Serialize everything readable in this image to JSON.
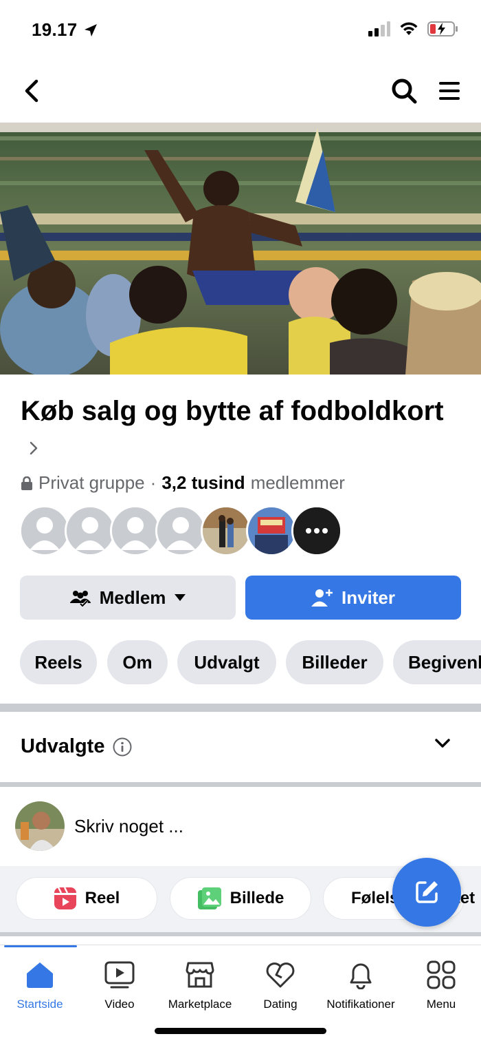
{
  "status_bar": {
    "time": "19.17"
  },
  "group": {
    "title": "Køb salg og bytte af fodboldkort",
    "privacy": "Privat gruppe",
    "separator": "·",
    "member_count": "3,2 tusind",
    "member_word": "medlemmer"
  },
  "buttons": {
    "member": "Medlem",
    "invite": "Inviter"
  },
  "chips": [
    "Reels",
    "Om",
    "Udvalgt",
    "Billeder",
    "Begivenheder"
  ],
  "featured": {
    "label": "Udvalgte"
  },
  "composer": {
    "placeholder": "Skriv noget ..."
  },
  "actions": [
    {
      "label": "Reel",
      "icon": "reel-icon"
    },
    {
      "label": "Billede",
      "icon": "photo-icon"
    },
    {
      "label": "Følelse/aktivitet",
      "icon": "feeling-icon"
    }
  ],
  "tabbar": [
    {
      "label": "Startside",
      "icon": "home-icon"
    },
    {
      "label": "Video",
      "icon": "video-icon"
    },
    {
      "label": "Marketplace",
      "icon": "marketplace-icon"
    },
    {
      "label": "Dating",
      "icon": "dating-icon"
    },
    {
      "label": "Notifikationer",
      "icon": "bell-icon"
    },
    {
      "label": "Menu",
      "icon": "menu-grid-icon"
    }
  ],
  "colors": {
    "accent": "#3578e5",
    "chip_bg": "#e4e6eb",
    "muted_text": "#65676b"
  }
}
